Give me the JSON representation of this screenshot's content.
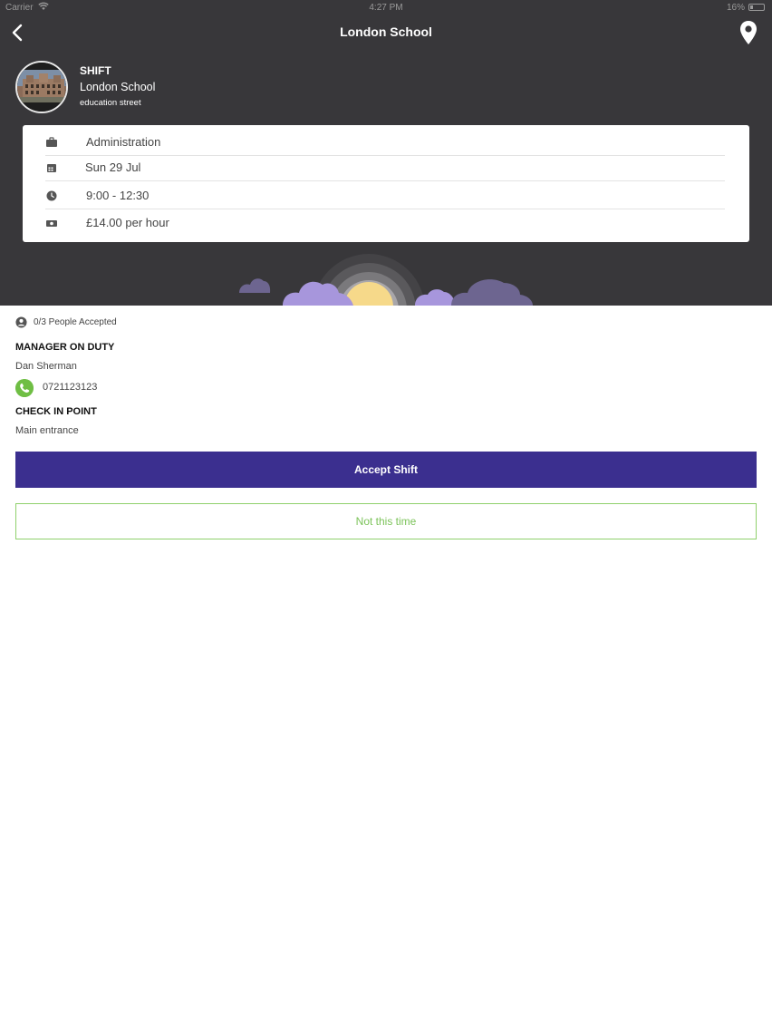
{
  "status_bar": {
    "carrier": "Carrier",
    "time": "4:27 PM",
    "battery": "16%"
  },
  "nav": {
    "title": "London School",
    "back_icon": "chevron-left-icon",
    "location_icon": "map-pin-icon"
  },
  "header": {
    "label": "SHIFT",
    "school_name": "London School",
    "street": "education street"
  },
  "details": {
    "department": "Administration",
    "date": "Sun 29 Jul",
    "time_range": "9:00 - 12:30",
    "pay": "£14.00 per hour"
  },
  "people_accepted": "0/3 People Accepted",
  "manager": {
    "heading": "MANAGER ON DUTY",
    "name": "Dan Sherman",
    "phone": "0721123123"
  },
  "checkin": {
    "heading": "CHECK IN POINT",
    "location": "Main entrance"
  },
  "actions": {
    "accept_label": "Accept Shift",
    "decline_label": "Not this time"
  },
  "colors": {
    "header_bg": "#38373a",
    "accept_bg": "#3b2f8f",
    "decline_text": "#7cc35a",
    "phone_icon": "#6fbe44"
  }
}
